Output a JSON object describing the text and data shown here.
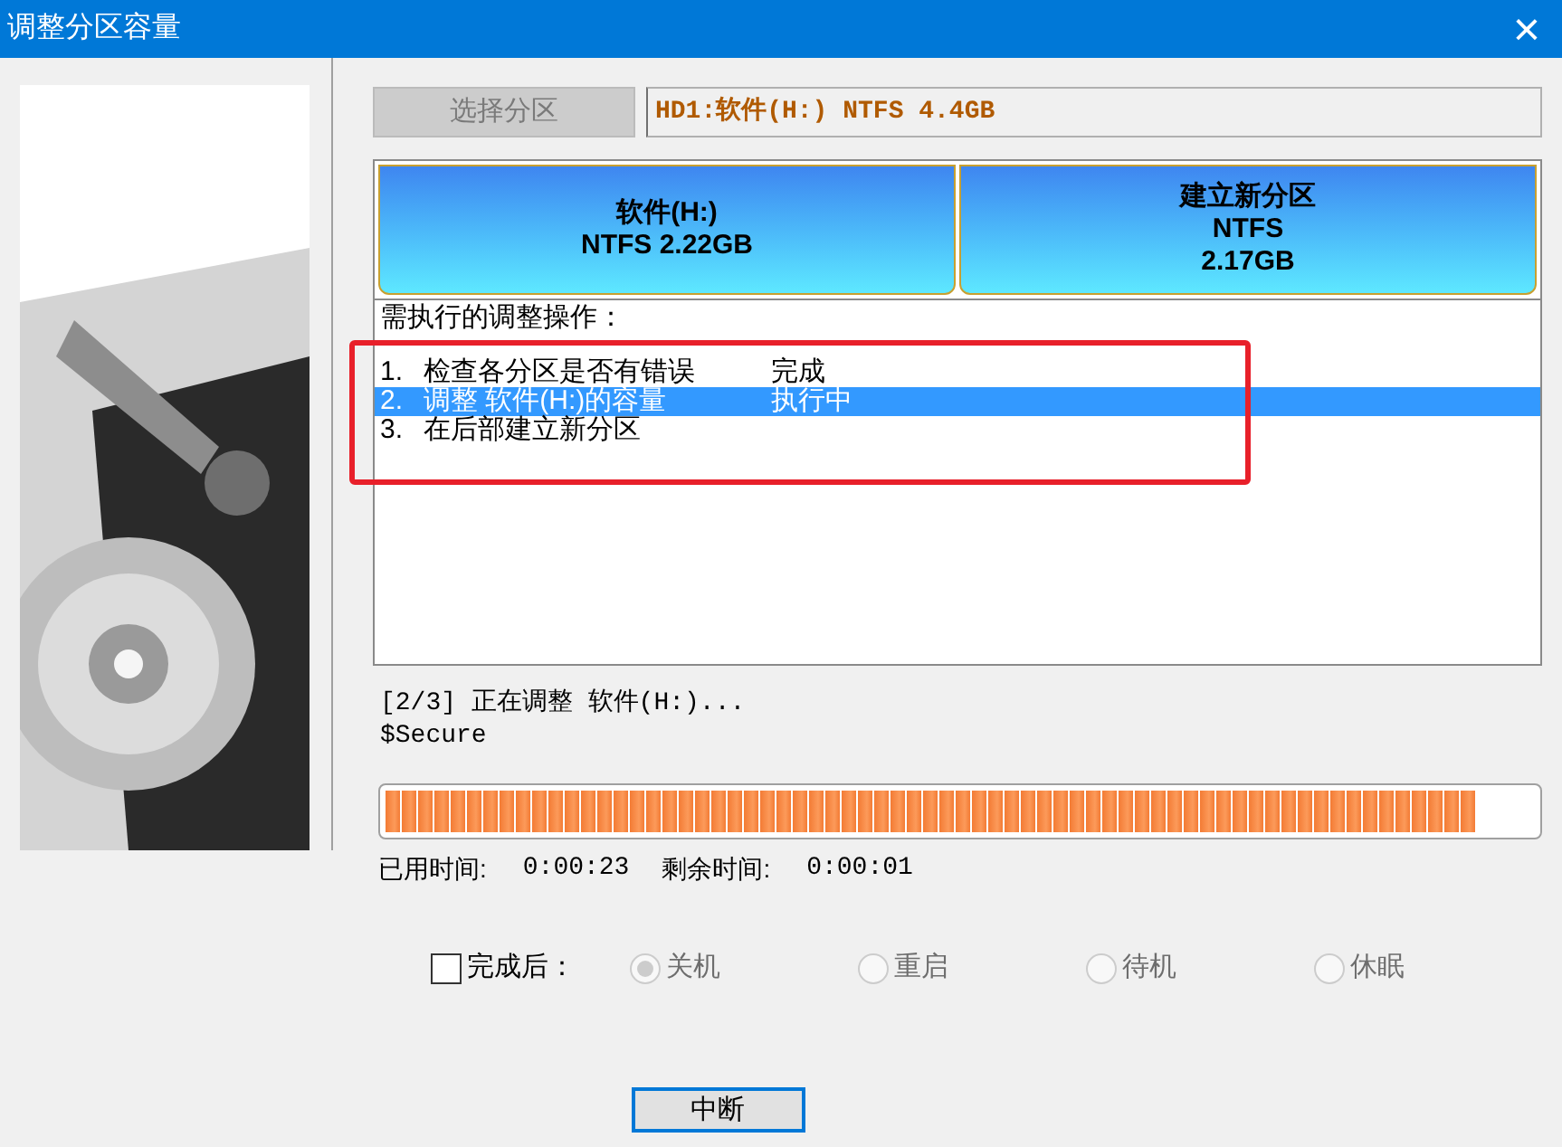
{
  "window": {
    "title": "调整分区容量",
    "close": "×"
  },
  "select_button": {
    "label": "选择分区",
    "disabled": true
  },
  "disk_field": {
    "value": "HD1:软件(H:) NTFS 4.4GB"
  },
  "partitions": [
    {
      "lines": [
        "软件(H:)",
        "NTFS 2.22GB"
      ]
    },
    {
      "lines": [
        "建立新分区",
        "NTFS",
        "2.17GB"
      ]
    }
  ],
  "operations": {
    "heading": "需执行的调整操作：",
    "items": [
      {
        "number": "1.",
        "text": "检查各分区是否有错误",
        "status": "完成",
        "selected": false
      },
      {
        "number": "2.",
        "text": "调整 软件(H:)的容量",
        "status": "执行中",
        "selected": true
      },
      {
        "number": "3.",
        "text": "在后部建立新分区",
        "selected": false
      }
    ]
  },
  "status_lines": [
    "[2/3] 正在调整 软件(H:)...",
    "$Secure"
  ],
  "progress": {
    "level": 0.95
  },
  "times": [
    {
      "label": "已用时间:",
      "value": "0:00:23"
    },
    {
      "label": "剩余时间:",
      "value": "0:00:01"
    }
  ],
  "after_done": {
    "label": "完成后：",
    "checked": false,
    "options": [
      {
        "label": "关机",
        "selected": true,
        "disabled": true
      },
      {
        "label": "重启",
        "selected": false,
        "disabled": true
      },
      {
        "label": "待机",
        "selected": false,
        "disabled": true
      },
      {
        "label": "休眠",
        "selected": false,
        "disabled": true
      }
    ]
  },
  "abort_button": {
    "label": "中断"
  }
}
